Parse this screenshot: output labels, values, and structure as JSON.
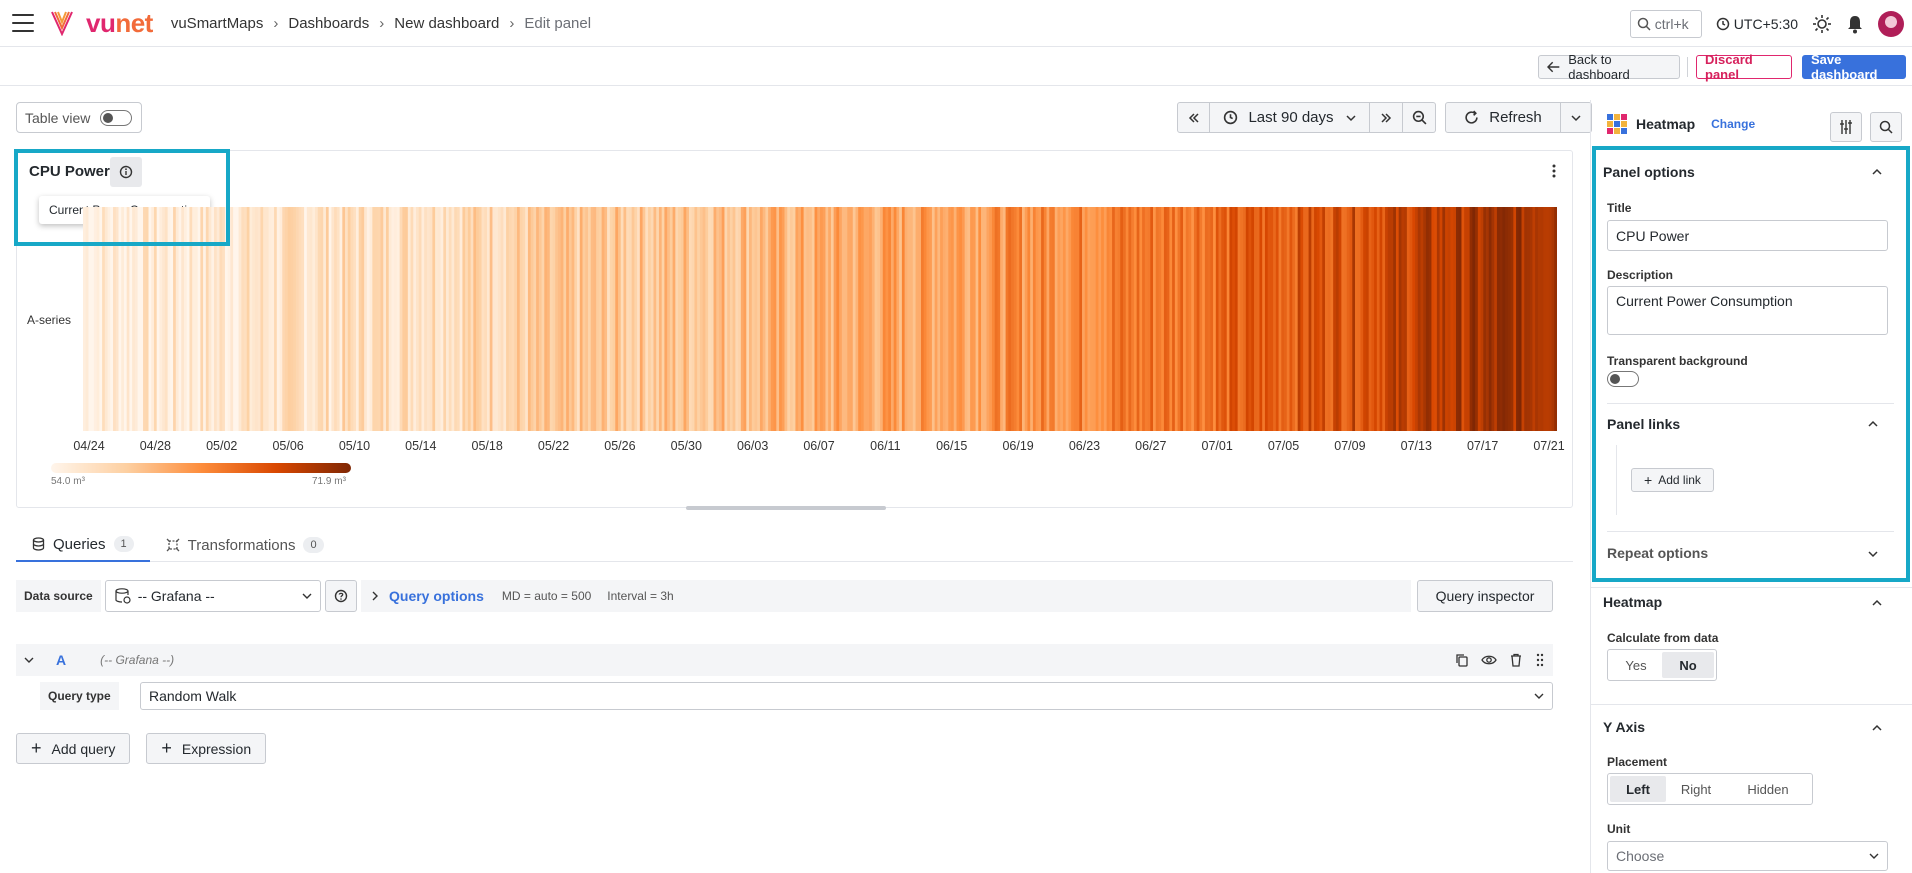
{
  "header": {
    "brand_vu": "vu",
    "brand_net": "net",
    "breadcrumb": [
      "vuSmartMaps",
      "Dashboards",
      "New dashboard",
      "Edit panel"
    ],
    "search_hint": "ctrl+k",
    "timezone": "UTC+5:30"
  },
  "actions": {
    "back": "Back to dashboard",
    "discard": "Discard panel",
    "save": "Save dashboard"
  },
  "toolbar": {
    "table_view": "Table view",
    "time_range": "Last 90 days",
    "refresh": "Refresh"
  },
  "panel": {
    "title": "CPU Power",
    "description_tooltip": "Current Power Consumption",
    "series_label": "A-series",
    "x_ticks": [
      "04/24",
      "04/28",
      "05/02",
      "05/06",
      "05/10",
      "05/14",
      "05/18",
      "05/22",
      "05/26",
      "05/30",
      "06/03",
      "06/07",
      "06/11",
      "06/15",
      "06/19",
      "06/23",
      "06/27",
      "07/01",
      "07/05",
      "07/09",
      "07/13",
      "07/17",
      "07/21"
    ],
    "legend_min": "54.0 m³",
    "legend_max": "71.9 m³",
    "colors": {
      "low": "#fff5eb",
      "mid": "#fd8d3c",
      "high": "#7f2704"
    }
  },
  "query_tabs": [
    {
      "label": "Queries",
      "count": "1"
    },
    {
      "label": "Transformations",
      "count": "0"
    }
  ],
  "query": {
    "data_source_label": "Data source",
    "data_source_value": "-- Grafana --",
    "options_title": "Query options",
    "md_meta": "MD = auto = 500",
    "interval_meta": "Interval = 3h",
    "inspector": "Query inspector",
    "row_letter": "A",
    "row_source": "(-- Grafana --)",
    "type_label": "Query type",
    "type_value": "Random Walk",
    "add_query": "Add query",
    "add_expression": "Expression"
  },
  "sidebar": {
    "viz_name": "Heatmap",
    "viz_change": "Change",
    "panel_options": {
      "title": "Panel options",
      "title_label": "Title",
      "title_value": "CPU Power",
      "desc_label": "Description",
      "desc_value": "Current Power Consumption",
      "transparent_label": "Transparent background"
    },
    "panel_links": {
      "title": "Panel links",
      "add_link": "Add link"
    },
    "repeat_options": {
      "title": "Repeat options"
    },
    "heatmap": {
      "title": "Heatmap",
      "calc_label": "Calculate from data",
      "options": [
        "Yes",
        "No"
      ],
      "selected": "No"
    },
    "y_axis": {
      "title": "Y Axis",
      "placement_label": "Placement",
      "placements": [
        "Left",
        "Right",
        "Hidden"
      ],
      "selected": "Left",
      "unit_label": "Unit",
      "unit_placeholder": "Choose"
    }
  }
}
